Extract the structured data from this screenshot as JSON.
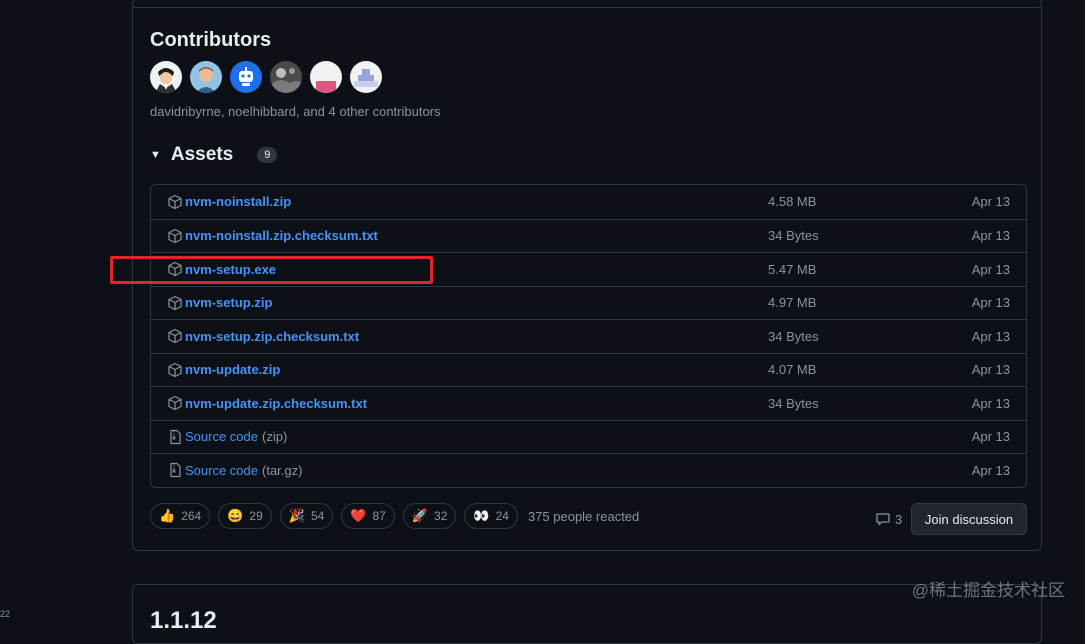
{
  "contributors": {
    "title": "Contributors",
    "text": "davidribyrne, noelhibbard, and 4 other contributors",
    "avatars": [
      "avatar-1",
      "avatar-2",
      "avatar-3",
      "avatar-4",
      "avatar-5",
      "avatar-6"
    ]
  },
  "assets": {
    "title": "Assets",
    "count": "9",
    "rows": [
      {
        "name": "nvm-noinstall.zip",
        "size": "4.58 MB",
        "date": "Apr 13",
        "icon": "package-icon"
      },
      {
        "name": "nvm-noinstall.zip.checksum.txt",
        "size": "34 Bytes",
        "date": "Apr 13",
        "icon": "package-icon"
      },
      {
        "name": "nvm-setup.exe",
        "size": "5.47 MB",
        "date": "Apr 13",
        "icon": "package-icon"
      },
      {
        "name": "nvm-setup.zip",
        "size": "4.97 MB",
        "date": "Apr 13",
        "icon": "package-icon"
      },
      {
        "name": "nvm-setup.zip.checksum.txt",
        "size": "34 Bytes",
        "date": "Apr 13",
        "icon": "package-icon"
      },
      {
        "name": "nvm-update.zip",
        "size": "4.07 MB",
        "date": "Apr 13",
        "icon": "package-icon"
      },
      {
        "name": "nvm-update.zip.checksum.txt",
        "size": "34 Bytes",
        "date": "Apr 13",
        "icon": "package-icon"
      }
    ],
    "source_rows": [
      {
        "name": "Source code",
        "suffix": "(zip)",
        "date": "Apr 13",
        "icon": "file-zip-icon"
      },
      {
        "name": "Source code",
        "suffix": "(tar.gz)",
        "date": "Apr 13",
        "icon": "file-zip-icon"
      }
    ]
  },
  "reactions": {
    "items": [
      {
        "emoji": "👍",
        "count": "264",
        "icon": "thumbs-up-icon"
      },
      {
        "emoji": "😄",
        "count": "29",
        "icon": "laugh-icon"
      },
      {
        "emoji": "🎉",
        "count": "54",
        "icon": "hooray-icon"
      },
      {
        "emoji": "❤️",
        "count": "87",
        "icon": "heart-icon"
      },
      {
        "emoji": "🚀",
        "count": "32",
        "icon": "rocket-icon"
      },
      {
        "emoji": "👀",
        "count": "24",
        "icon": "eyes-icon"
      }
    ],
    "summary": "375 people reacted"
  },
  "discussion": {
    "comment_count": "3",
    "join_label": "Join discussion"
  },
  "next_release": {
    "title": "1.1.12"
  },
  "watermark": "@稀土掘金技术社区",
  "edge_text": "22",
  "colors": {
    "link": "#4493f8",
    "highlight": "#e3242b",
    "background": "#0d1117",
    "border": "#30363d"
  }
}
